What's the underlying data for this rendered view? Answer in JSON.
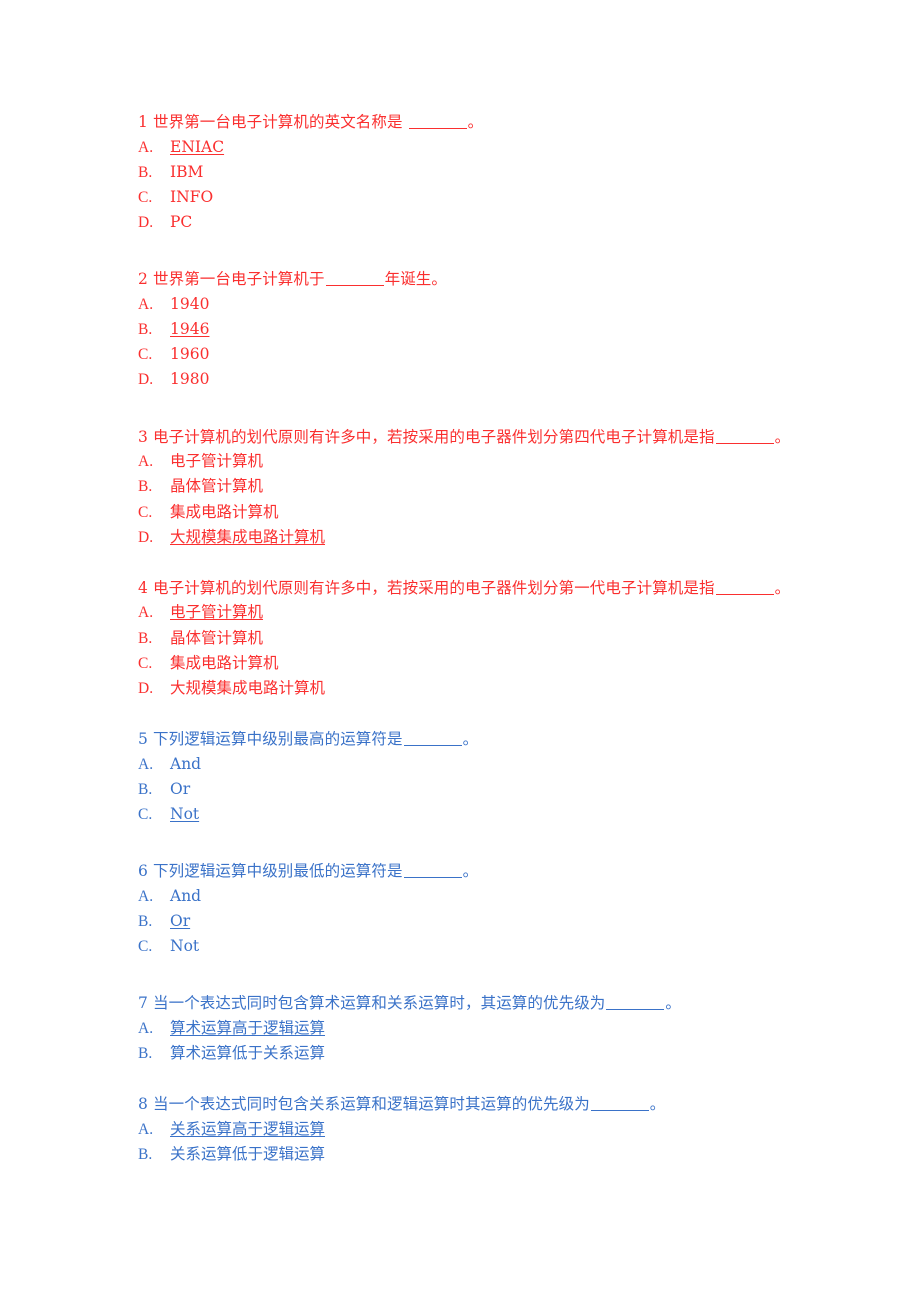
{
  "document": {
    "title": "计算机基础选择题",
    "page_background": "#ffffff",
    "colors": {
      "red": "#fa2f2f",
      "blue": "#3a72c8"
    }
  },
  "questions": [
    {
      "number": "1",
      "color": "red",
      "stem_before_blank": "1 世界第一台电子计算机的英文名称是 ",
      "stem_after_blank": "。",
      "stem_lines": [
        "1 世界第一台电子计算机的英文名称是 ",
        "。"
      ],
      "options": [
        {
          "letter": "A.",
          "text": "ENIAC",
          "underlined": true
        },
        {
          "letter": "B.",
          "text": "IBM",
          "underlined": false
        },
        {
          "letter": "C.",
          "text": "INFO",
          "underlined": false
        },
        {
          "letter": "D.",
          "text": "PC",
          "underlined": false
        }
      ]
    },
    {
      "number": "2",
      "color": "red",
      "stem_before_blank": "2 世界第一台电子计算机于",
      "stem_after_blank": "年诞生。",
      "options": [
        {
          "letter": "A.",
          "text": "1940",
          "underlined": false
        },
        {
          "letter": "B.",
          "text": "1946",
          "underlined": true
        },
        {
          "letter": "C.",
          "text": "1960",
          "underlined": false
        },
        {
          "letter": "D.",
          "text": "1980",
          "underlined": false
        }
      ]
    },
    {
      "number": "3",
      "color": "red",
      "stem_before_blank": "3 电子计算机的划代原则有许多中，若按采用的电子器件划分第四代电子计算机是指",
      "stem_after_blank": "。",
      "wraps": true,
      "options": [
        {
          "letter": "A.",
          "text": "电子管计算机",
          "underlined": false
        },
        {
          "letter": "B.",
          "text": "晶体管计算机",
          "underlined": false
        },
        {
          "letter": "C.",
          "text": "集成电路计算机",
          "underlined": false
        },
        {
          "letter": "D.",
          "text": "大规模集成电路计算机",
          "underlined": true
        }
      ]
    },
    {
      "number": "4",
      "color": "red",
      "stem_before_blank": "4 电子计算机的划代原则有许多中，若按采用的电子器件划分第一代电子计算机是指",
      "stem_after_blank": "。",
      "wraps": true,
      "options": [
        {
          "letter": "A.",
          "text": "电子管计算机",
          "underlined": true
        },
        {
          "letter": "B.",
          "text": "晶体管计算机",
          "underlined": false
        },
        {
          "letter": "C.",
          "text": "集成电路计算机",
          "underlined": false
        },
        {
          "letter": "D.",
          "text": "大规模集成电路计算机",
          "underlined": false
        }
      ]
    },
    {
      "number": "5",
      "color": "blue",
      "stem_before_blank": "5 下列逻辑运算中级别最高的运算符是",
      "stem_after_blank": "。",
      "options": [
        {
          "letter": "A.",
          "text": "And",
          "underlined": false
        },
        {
          "letter": "B.",
          "text": "Or",
          "underlined": false
        },
        {
          "letter": "C.",
          "text": "Not",
          "underlined": true
        }
      ]
    },
    {
      "number": "6",
      "color": "blue",
      "stem_before_blank": "6 下列逻辑运算中级别最低的运算符是",
      "stem_after_blank": "。",
      "options": [
        {
          "letter": "A.",
          "text": "And",
          "underlined": false
        },
        {
          "letter": "B.",
          "text": "Or",
          "underlined": true
        },
        {
          "letter": "C.",
          "text": "Not",
          "underlined": false
        }
      ]
    },
    {
      "number": "7",
      "color": "blue",
      "stem_before_blank": "7 当一个表达式同时包含算术运算和关系运算时，其运算的优先级为",
      "stem_after_blank": "。",
      "options": [
        {
          "letter": "A.",
          "text": "算术运算高于逻辑运算",
          "underlined": true
        },
        {
          "letter": "B.",
          "text": "算术运算低于关系运算",
          "underlined": false
        }
      ]
    },
    {
      "number": "8",
      "color": "blue",
      "stem_before_blank": "8 当一个表达式同时包含关系运算和逻辑运算时其运算的优先级为",
      "stem_after_blank": "。",
      "options": [
        {
          "letter": "A.",
          "text": "关系运算高于逻辑运算",
          "underlined": true
        },
        {
          "letter": "B.",
          "text": "关系运算低于逻辑运算",
          "underlined": false
        }
      ]
    }
  ]
}
